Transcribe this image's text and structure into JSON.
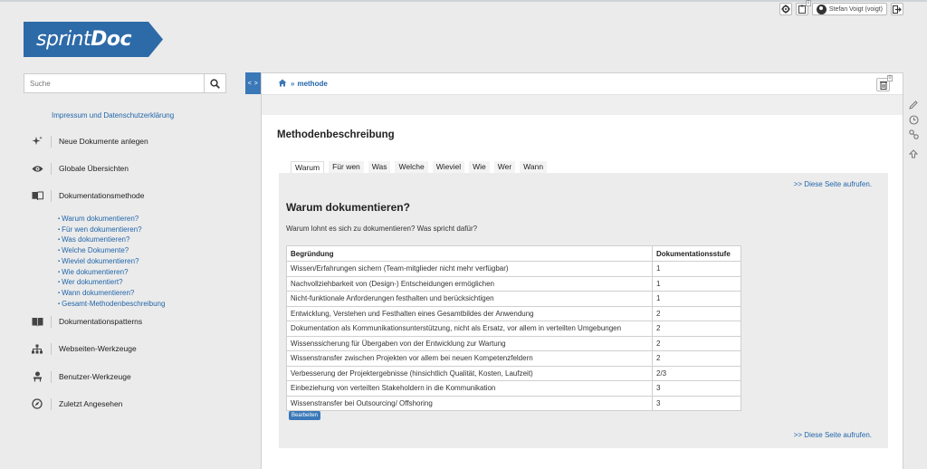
{
  "topbar": {
    "gear_icon": "gear-icon",
    "clipboard_icon": "clipboard-icon",
    "clipboard_badge": "0",
    "user_label": "Stefan Voigt (voigt)",
    "logout_icon": "logout-icon"
  },
  "logo": {
    "part1": "sprint",
    "part2": "Doc",
    "color": "#2d6aa8"
  },
  "search": {
    "placeholder": "Suche",
    "value": "",
    "icon": "search-icon"
  },
  "sidebar": {
    "top_link": "Impressum und Datenschutzerklärung",
    "items": [
      {
        "label": "Neue Dokumente anlegen",
        "icon": "sparkle-icon"
      },
      {
        "label": "Globale Übersichten",
        "icon": "eye-icon"
      },
      {
        "label": "Dokumentationsmethode",
        "icon": "book-icon"
      },
      {
        "label": "Dokumentationspatterns",
        "icon": "book-open-icon"
      },
      {
        "label": "Webseiten-Werkzeuge",
        "icon": "sitemap-icon"
      },
      {
        "label": "Benutzer-Werkzeuge",
        "icon": "user-icon"
      },
      {
        "label": "Zuletzt Angesehen",
        "icon": "compass-icon"
      }
    ],
    "sub_links": [
      "Warum dokumentieren?",
      "Für wen dokumentieren?",
      "Was dokumentieren?",
      "Welche Dokumente?",
      "Wieviel dokumentieren?",
      "Wie dokumentieren?",
      "Wer dokumentiert?",
      "Wann dokumentieren?",
      "Gesamt-Methodenbeschreibung"
    ]
  },
  "toggle_label": "< >",
  "breadcrumb": {
    "home_icon": "home-icon",
    "separator": "»",
    "current": "methode"
  },
  "panel_trash_badge": "0",
  "page_title": "Methodenbeschreibung",
  "tabs": [
    "Warum",
    "Für wen",
    "Was",
    "Welche",
    "Wieviel",
    "Wie",
    "Wer",
    "Wann"
  ],
  "active_tab": "Warum",
  "section": {
    "link_top": ">> Diese Seite aufrufen.",
    "heading": "Warum dokumentieren?",
    "lead": "Warum lohnt es sich zu dokumentieren? Was spricht dafür?",
    "table": {
      "headers": [
        "Begründung",
        "Dokumentationsstufe"
      ],
      "rows": [
        [
          "Wissen/Erfahrungen sichern (Team-mitglieder nicht mehr verfügbar)",
          "1"
        ],
        [
          "Nachvollziehbarkeit von (Design-) Entscheidungen ermöglichen",
          "1"
        ],
        [
          "Nicht-funktionale Anforderungen festhalten und berücksichtigen",
          "1"
        ],
        [
          "Entwicklung, Verstehen und Festhalten eines Gesamtbildes der Anwendung",
          "2"
        ],
        [
          "Dokumentation als Kommunikationsunterstützung, nicht als Ersatz, vor allem in verteilten Umgebungen",
          "2"
        ],
        [
          "Wissenssicherung für Übergaben von der Entwicklung zur Wartung",
          "2"
        ],
        [
          "Wissenstransfer zwischen Projekten vor allem bei neuen Kompetenzfeldern",
          "2"
        ],
        [
          "Verbesserung der Projektergebnisse (hinsichtlich Qualität, Kosten, Laufzeit)",
          "2/3"
        ],
        [
          "Einbeziehung von verteilten Stakeholdern in die Kommunikation",
          "3"
        ],
        [
          "Wissenstransfer bei Outsourcing/ Offshoring",
          "3"
        ]
      ]
    },
    "edit_button": "Bearbeiten",
    "link_bottom": ">> Diese Seite aufrufen."
  },
  "right_rail": [
    "pencil-icon",
    "clock-icon",
    "link-icon",
    "arrow-up-icon"
  ],
  "accent_color": "#3a78b8",
  "link_color": "#2266aa"
}
